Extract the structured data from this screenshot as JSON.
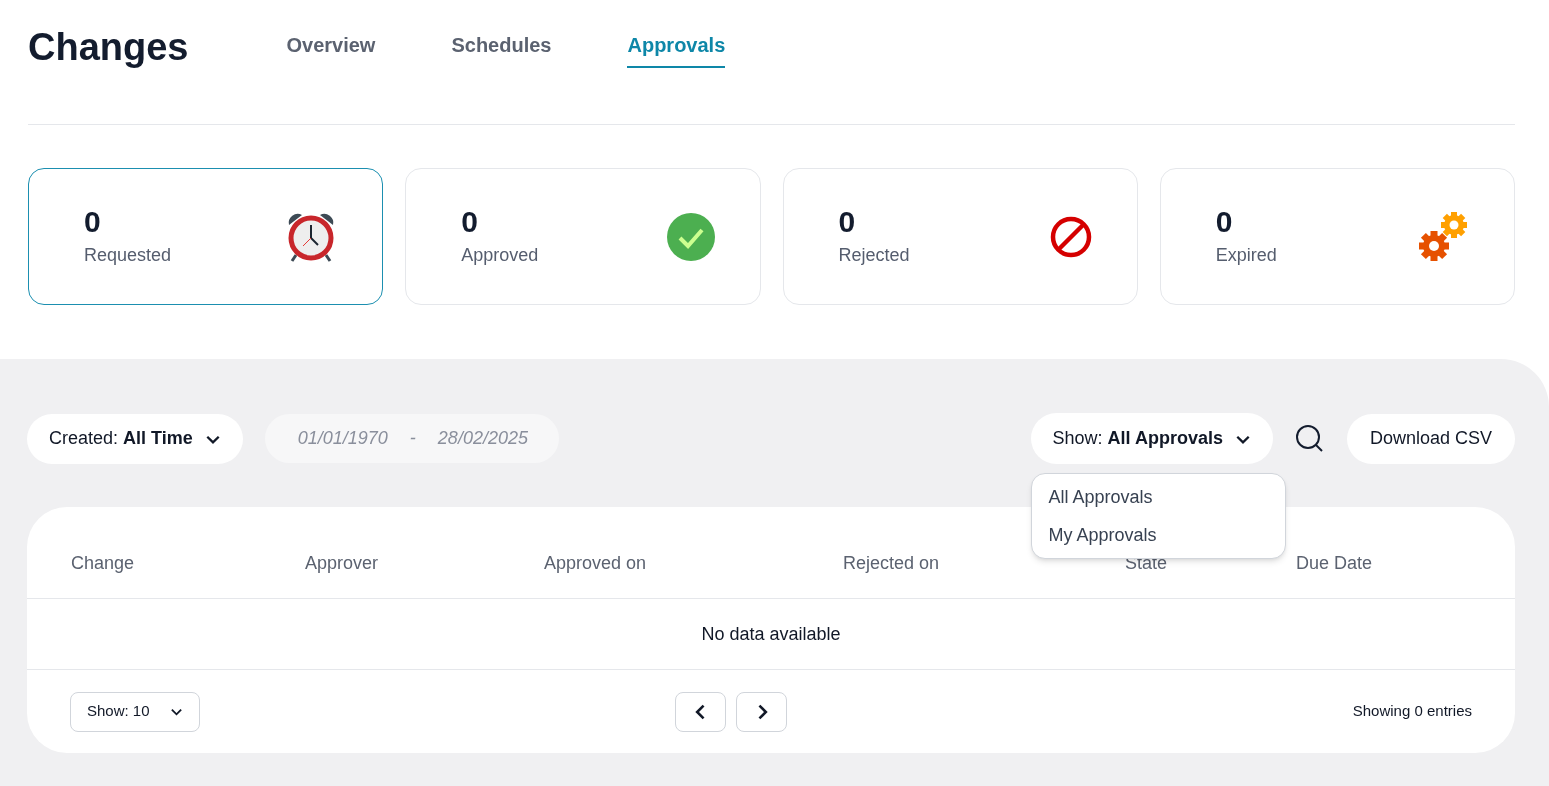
{
  "title": "Changes",
  "tabs": [
    {
      "label": "Overview",
      "selected": false
    },
    {
      "label": "Schedules",
      "selected": false
    },
    {
      "label": "Approvals",
      "selected": true
    }
  ],
  "stats": [
    {
      "count": "0",
      "label": "Requested",
      "kind": "clock",
      "selected": true
    },
    {
      "count": "0",
      "label": "Approved",
      "kind": "check",
      "selected": false
    },
    {
      "count": "0",
      "label": "Rejected",
      "kind": "blocked",
      "selected": false
    },
    {
      "count": "0",
      "label": "Expired",
      "kind": "gears",
      "selected": false
    }
  ],
  "filters": {
    "created": {
      "label": "Created:",
      "value": "All Time"
    },
    "date_from": "01/01/1970",
    "date_separator": "-",
    "date_to": "28/02/2025",
    "show": {
      "label": "Show:",
      "value": "All Approvals",
      "expanded": true,
      "options": [
        "All Approvals",
        "My Approvals"
      ]
    },
    "download": "Download CSV"
  },
  "table": {
    "columns": [
      "Change",
      "Approver",
      "Approved on",
      "Rejected on",
      "State",
      "Due Date"
    ],
    "empty": "No data available",
    "page_size": "Show: 10",
    "summary": "Showing 0 entries"
  }
}
